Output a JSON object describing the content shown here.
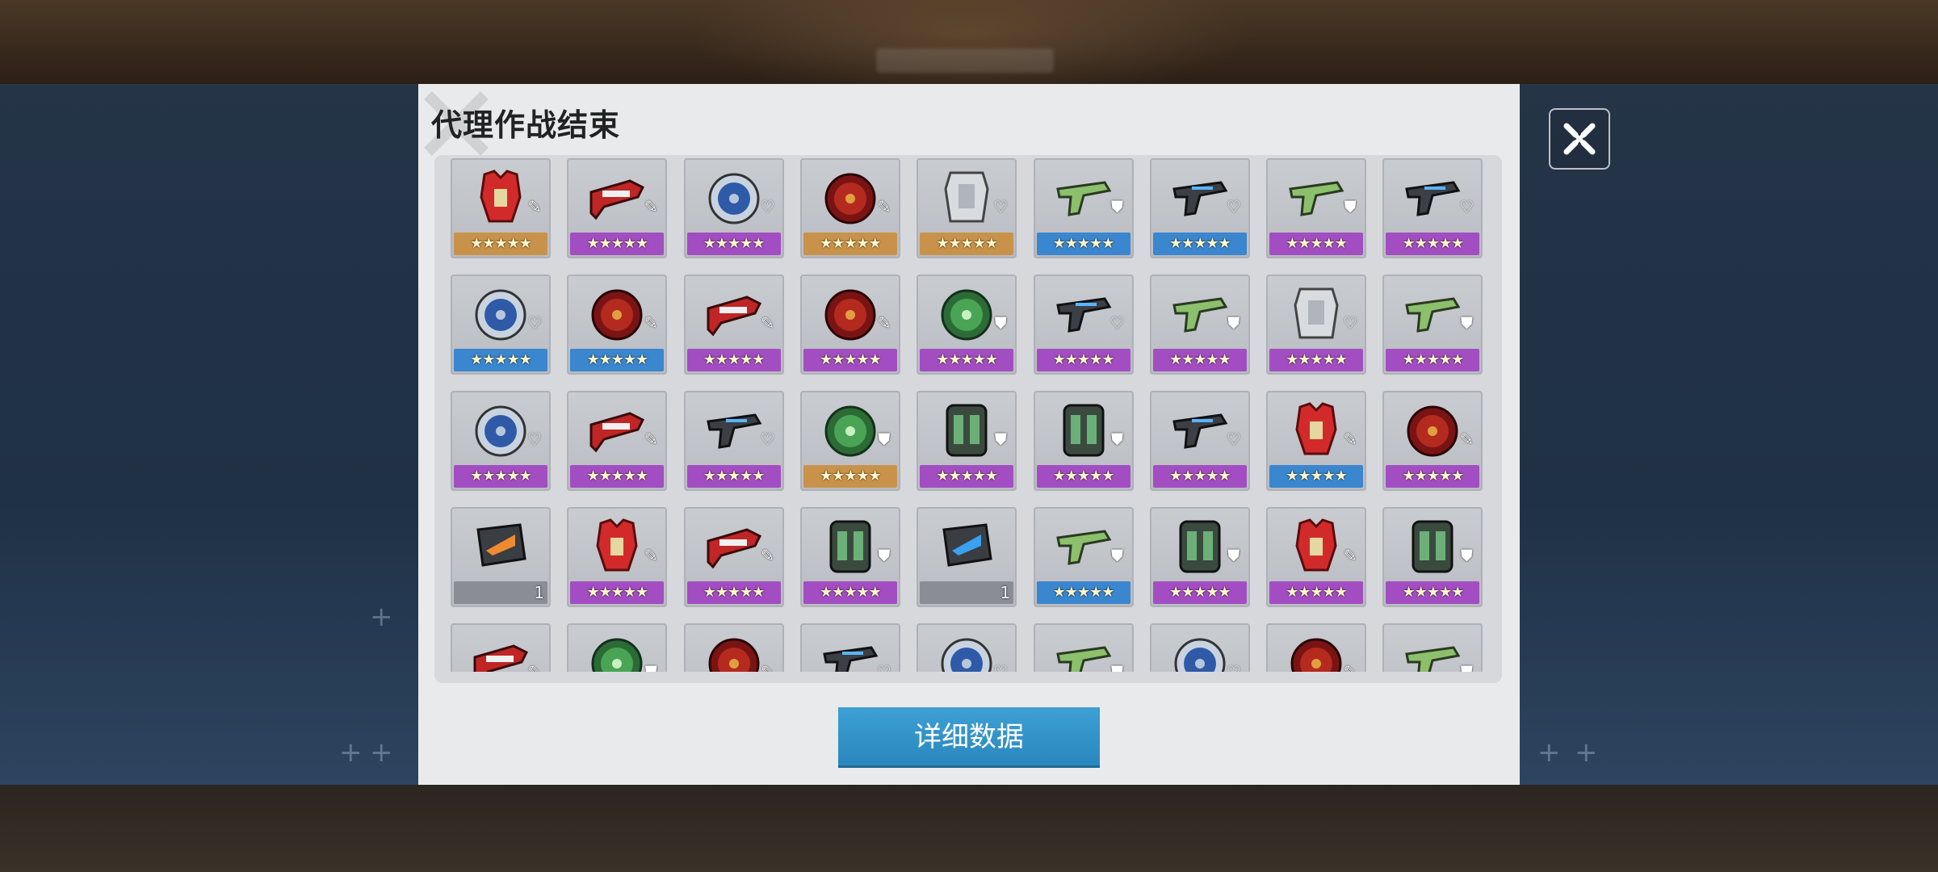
{
  "dialog": {
    "title": "代理作战结束",
    "detail_button": "详细数据"
  },
  "colors": {
    "tier_orange": "#c9924a",
    "tier_purple": "#a24ec2",
    "tier_blue": "#3a86cf",
    "tier_gray": "#8a8d93",
    "button_blue": "#3a9dd2"
  },
  "stars_text": "★★★★★",
  "items": [
    {
      "icon": "red-armor-icon",
      "tier": "orange",
      "badge": "pencil"
    },
    {
      "icon": "red-scope-icon",
      "tier": "purple",
      "badge": "pencil"
    },
    {
      "icon": "blue-disc-icon",
      "tier": "purple",
      "badge": "heart"
    },
    {
      "icon": "red-disc-icon",
      "tier": "orange",
      "badge": "pencil"
    },
    {
      "icon": "gray-plate-icon",
      "tier": "orange",
      "badge": "heart"
    },
    {
      "icon": "green-pistol-icon",
      "tier": "blue",
      "badge": "shield"
    },
    {
      "icon": "black-pistol-icon",
      "tier": "blue",
      "badge": "heart"
    },
    {
      "icon": "green-pistol-icon",
      "tier": "purple",
      "badge": "shield"
    },
    {
      "icon": "black-pistol-icon",
      "tier": "purple",
      "badge": "heart"
    },
    {
      "icon": "blue-disc-icon",
      "tier": "blue",
      "badge": "heart"
    },
    {
      "icon": "red-disc-icon",
      "tier": "blue",
      "badge": "pencil"
    },
    {
      "icon": "red-scope-icon",
      "tier": "purple",
      "badge": "pencil"
    },
    {
      "icon": "red-disc-icon",
      "tier": "purple",
      "badge": "pencil"
    },
    {
      "icon": "green-disc-icon",
      "tier": "purple",
      "badge": "shield"
    },
    {
      "icon": "black-pistol-icon",
      "tier": "purple",
      "badge": "heart"
    },
    {
      "icon": "green-pistol-icon",
      "tier": "purple",
      "badge": "shield"
    },
    {
      "icon": "gray-plate-icon",
      "tier": "purple",
      "badge": "heart"
    },
    {
      "icon": "green-pistol-icon",
      "tier": "purple",
      "badge": "shield"
    },
    {
      "icon": "blue-disc-icon",
      "tier": "purple",
      "badge": "heart"
    },
    {
      "icon": "red-scope-icon",
      "tier": "purple",
      "badge": "pencil"
    },
    {
      "icon": "black-pistol-icon",
      "tier": "purple",
      "badge": "heart"
    },
    {
      "icon": "green-disc-icon",
      "tier": "orange",
      "badge": "shield"
    },
    {
      "icon": "green-vest-icon",
      "tier": "purple",
      "badge": "shield"
    },
    {
      "icon": "green-vest-icon",
      "tier": "purple",
      "badge": "shield"
    },
    {
      "icon": "black-pistol-icon",
      "tier": "purple",
      "badge": "heart"
    },
    {
      "icon": "red-armor-icon",
      "tier": "blue",
      "badge": "pencil"
    },
    {
      "icon": "red-disc-icon",
      "tier": "purple",
      "badge": "pencil"
    },
    {
      "icon": "orange-chip-icon",
      "tier": "gray",
      "badge": "",
      "count": "1"
    },
    {
      "icon": "red-armor-icon",
      "tier": "purple",
      "badge": "pencil"
    },
    {
      "icon": "red-scope-icon",
      "tier": "purple",
      "badge": "pencil"
    },
    {
      "icon": "green-vest-icon",
      "tier": "purple",
      "badge": "shield"
    },
    {
      "icon": "blue-chip-icon",
      "tier": "gray",
      "badge": "",
      "count": "1"
    },
    {
      "icon": "green-pistol-icon",
      "tier": "blue",
      "badge": "shield"
    },
    {
      "icon": "green-vest-icon",
      "tier": "purple",
      "badge": "shield"
    },
    {
      "icon": "red-armor-icon",
      "tier": "purple",
      "badge": "pencil"
    },
    {
      "icon": "green-vest-icon",
      "tier": "purple",
      "badge": "shield"
    },
    {
      "icon": "red-scope-icon",
      "tier": "purple",
      "badge": "pencil"
    },
    {
      "icon": "green-disc-icon",
      "tier": "purple",
      "badge": "shield"
    },
    {
      "icon": "red-disc-icon",
      "tier": "purple",
      "badge": "pencil"
    },
    {
      "icon": "black-pistol-icon",
      "tier": "purple",
      "badge": "heart"
    },
    {
      "icon": "blue-disc-icon",
      "tier": "purple",
      "badge": "heart"
    },
    {
      "icon": "green-pistol-icon",
      "tier": "purple",
      "badge": "shield"
    },
    {
      "icon": "blue-disc-icon",
      "tier": "purple",
      "badge": "heart"
    },
    {
      "icon": "red-disc-icon",
      "tier": "purple",
      "badge": "pencil"
    },
    {
      "icon": "green-pistol-icon",
      "tier": "purple",
      "badge": "shield"
    }
  ]
}
